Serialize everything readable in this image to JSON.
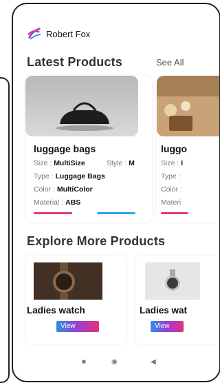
{
  "app": {
    "user_name": "Robert Fox"
  },
  "colors": {
    "accent_gradient": [
      "#2d8fe6",
      "#9b3fd1",
      "#e4327c"
    ],
    "bar_pink": "#e23f6b",
    "bar_blue": "#2ba4e6"
  },
  "latest": {
    "title": "Latest Products",
    "see_all": "See All",
    "cards": [
      {
        "title": "luggage bags",
        "size_label": "Size : ",
        "size_value": "MultiSize",
        "style_label": "Style : ",
        "style_value": "M",
        "type_label": "Type : ",
        "type_value": "Luggage Bags",
        "color_label": "Color : ",
        "color_value": "MultiColor",
        "material_label": "Material : ",
        "material_value": "ABS"
      },
      {
        "title": "luggo",
        "size_label": "Size : ",
        "size_value": "I",
        "type_label": "Type : ",
        "color_label": "Color : ",
        "material_label": "Materi"
      }
    ]
  },
  "explore": {
    "title": "Explore More Products",
    "items": [
      {
        "title": "Ladies watch",
        "button": "View"
      },
      {
        "title": "Ladies wat",
        "button": "View"
      }
    ]
  },
  "nav": {
    "icons": [
      "recent-apps-icon",
      "home-icon",
      "back-icon"
    ]
  }
}
